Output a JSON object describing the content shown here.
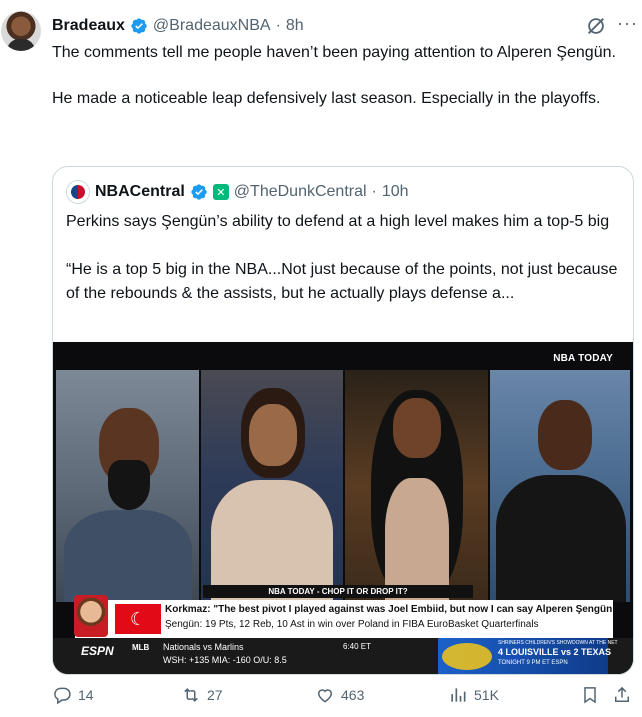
{
  "tweet": {
    "author_name": "Bradeaux",
    "handle": "@BradeauxNBA",
    "separator": "·",
    "time": "8h",
    "text_paragraphs": [
      "The comments tell me people haven’t been paying attention to Alperen Şengün.",
      "He made a noticeable leap defensively last season. Especially in the playoffs."
    ]
  },
  "quote": {
    "author_name": "NBACentral",
    "handle": "@TheDunkCentral",
    "separator": "·",
    "time": "10h",
    "affiliate_mark": "✕",
    "text_paragraphs": [
      "Perkins says Şengün’s ability to defend at a high level makes him a top-5 big",
      "“He is a top 5 big in the NBA...Not just because of the points, not just because of the rebounds & the assists, but he actually plays defense a..."
    ],
    "media": {
      "brand_label": "NBA TODAY",
      "lower_third": "NBA TODAY - CHOP IT OR DROP IT?",
      "ticker_line1": "Korkmaz: \"The best pivot I played against was Joel Embiid, but now I can say Alperen Şengün\"",
      "ticker_line2": "Şengün: 19 Pts, 12 Reb, 10 Ast in win over Poland in FIBA EuroBasket Quarterfinals",
      "flag_glyph": "☾",
      "network": "ESPN",
      "league": "MLB",
      "game_line1": "Nationals vs Marlins",
      "game_line2": "WSH: +135   MIA: -160   O/U: 8.5",
      "game_time": "6:40 ET",
      "promo_line1": "SHRINERS CHILDREN'S SHOWDOWN AT THE NET",
      "promo_line2": "4 LOUISVILLE vs 2 TEXAS",
      "promo_line3": "TONIGHT 9 PM ET  ESPN"
    }
  },
  "actions": {
    "replies": "14",
    "reposts": "27",
    "likes": "463",
    "views": "51K"
  },
  "colors": {
    "verified": "#1d9bf0",
    "muted_text": "#536471",
    "border": "#cfd9de",
    "affiliate": "#00ba7c"
  },
  "icons": [
    "verified-badge-icon",
    "grok-icon",
    "more-icon",
    "reply-icon",
    "repost-icon",
    "like-icon",
    "views-icon",
    "bookmark-icon",
    "share-icon"
  ]
}
